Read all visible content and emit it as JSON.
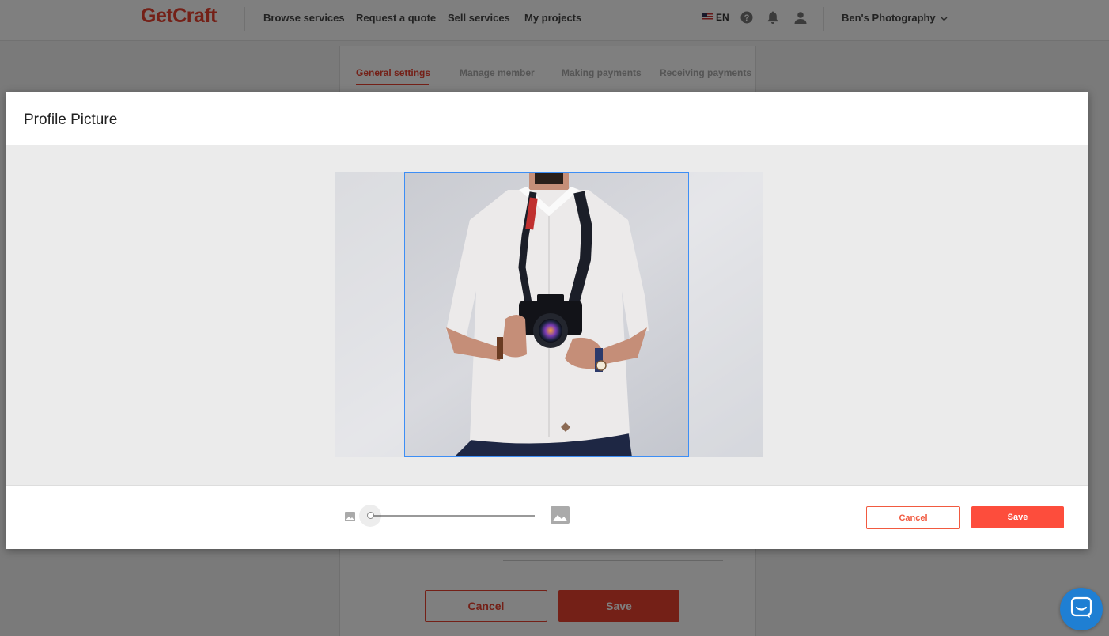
{
  "nav": {
    "logo": "GetCraft",
    "links": [
      "Browse services",
      "Request a quote",
      "Sell services",
      "My projects"
    ],
    "language": "EN",
    "user": "Ben's Photography"
  },
  "settings": {
    "tabs": [
      "General settings",
      "Manage member",
      "Making payments",
      "Receiving payments"
    ],
    "active_tab": 0,
    "cancel_label": "Cancel",
    "save_label": "Save"
  },
  "modal": {
    "title": "Profile Picture",
    "zoom_level": 0,
    "cancel_label": "Cancel",
    "save_label": "Save"
  },
  "colors": {
    "brand": "#e8412f",
    "save_button": "#fd4d3c",
    "crop_border": "#3d8ef5",
    "chat": "#1f7fd3"
  }
}
